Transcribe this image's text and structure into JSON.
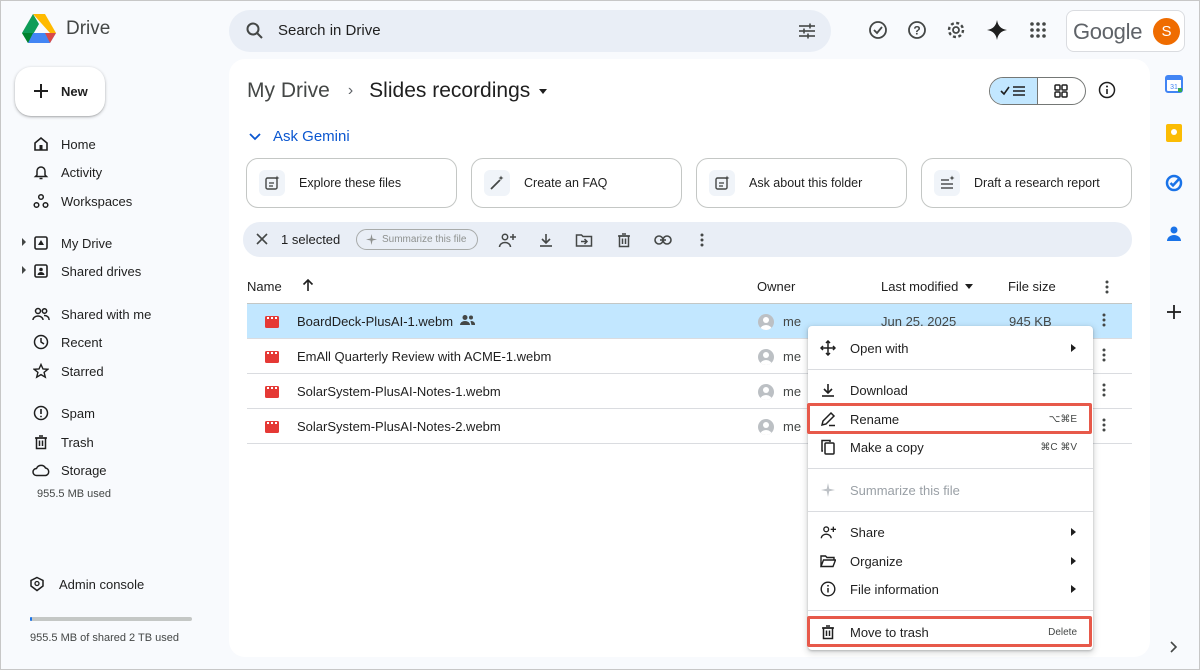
{
  "header": {
    "app_name": "Drive",
    "search_placeholder": "Search in Drive",
    "account_brand": "Google",
    "avatar_letter": "S",
    "icons": [
      "offline-ready-icon",
      "help-icon",
      "settings-icon",
      "gemini-icon",
      "apps-grid-icon"
    ]
  },
  "sidebar": {
    "new_label": "New",
    "items": [
      {
        "label": "Home",
        "icon": "home-icon"
      },
      {
        "label": "Activity",
        "icon": "bell-icon"
      },
      {
        "label": "Workspaces",
        "icon": "workspaces-icon"
      },
      {
        "label": "My Drive",
        "icon": "my-drive-icon"
      },
      {
        "label": "Shared drives",
        "icon": "shared-drives-icon"
      },
      {
        "label": "Shared with me",
        "icon": "people-icon"
      },
      {
        "label": "Recent",
        "icon": "clock-icon"
      },
      {
        "label": "Starred",
        "icon": "star-icon"
      },
      {
        "label": "Spam",
        "icon": "spam-icon"
      },
      {
        "label": "Trash",
        "icon": "trash-icon"
      },
      {
        "label": "Storage",
        "icon": "cloud-icon"
      }
    ],
    "storage_used": "955.5 MB used",
    "admin_label": "Admin console",
    "shared_storage_text": "955.5 MB of shared 2 TB used",
    "shared_storage_fraction": 0.005
  },
  "main": {
    "breadcrumb_root": "My Drive",
    "breadcrumb_current": "Slides recordings",
    "ask_gemini_label": "Ask Gemini",
    "suggestions": [
      "Explore these files",
      "Create an FAQ",
      "Ask about this folder",
      "Draft a research report"
    ],
    "selection": {
      "count_text": "1 selected",
      "summarize_label": "Summarize this file"
    },
    "columns": {
      "name": "Name",
      "owner": "Owner",
      "modified": "Last modified",
      "size": "File size"
    },
    "files": [
      {
        "name": "BoardDeck-PlusAI-1.webm",
        "owner": "me",
        "modified": "Jun 25, 2025",
        "size": "945 KB",
        "shared": true,
        "selected": true
      },
      {
        "name": "EmAll Quarterly Review with ACME-1.webm",
        "owner": "me",
        "modified": "",
        "size": "",
        "shared": false,
        "selected": false
      },
      {
        "name": "SolarSystem-PlusAI-Notes-1.webm",
        "owner": "me",
        "modified": "",
        "size": "",
        "shared": false,
        "selected": false
      },
      {
        "name": "SolarSystem-PlusAI-Notes-2.webm",
        "owner": "me",
        "modified": "",
        "size": "",
        "shared": false,
        "selected": false
      }
    ]
  },
  "context_menu": {
    "open_with": "Open with",
    "download": "Download",
    "rename": "Rename",
    "rename_key": "⌥⌘E",
    "copy": "Make a copy",
    "copy_key": "⌘C ⌘V",
    "summarize": "Summarize this file",
    "share": "Share",
    "organize": "Organize",
    "file_info": "File information",
    "trash": "Move to trash",
    "trash_key": "Delete"
  },
  "colors": {
    "accent": "#0b57d0",
    "selection": "#c2e7ff",
    "highlight_box": "#e7594a",
    "video_file": "#e53935"
  }
}
